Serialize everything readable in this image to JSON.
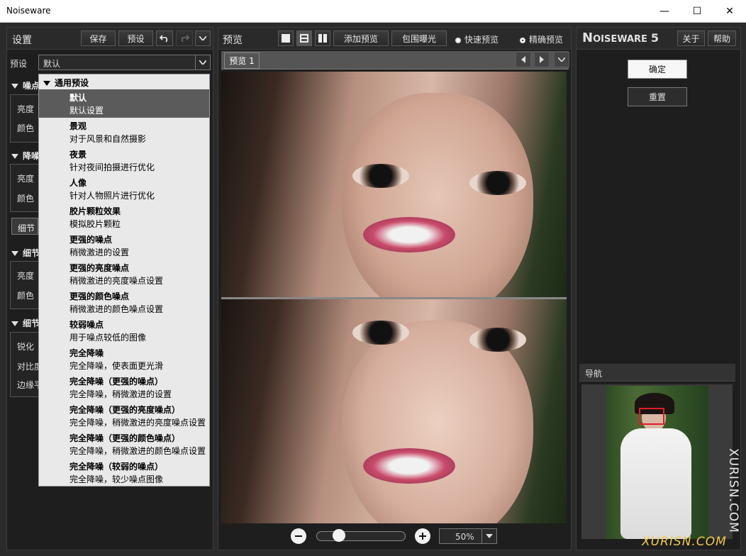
{
  "window": {
    "title": "Noiseware",
    "minimize": "—",
    "maximize": "☐",
    "close": "✕"
  },
  "left": {
    "title": "设置",
    "save": "保存",
    "preset_btn": "预设",
    "preset_label": "预设",
    "preset_value": "默认",
    "sections": [
      {
        "title": "噪点",
        "rows": [
          "亮度",
          "颜色"
        ]
      },
      {
        "title": "降噪",
        "rows": [
          "亮度",
          "颜色"
        ]
      },
      {
        "title": "细节",
        "rows": [
          "亮度",
          "颜色"
        ]
      },
      {
        "title": "细节",
        "rows": [
          "锐化",
          "对比度",
          "边缘平"
        ]
      }
    ],
    "detail_tab": "细节"
  },
  "dropdown": {
    "header": "通用预设",
    "items": [
      {
        "name": "默认",
        "desc": "默认设置"
      },
      {
        "name": "景观",
        "desc": "对于风景和自然摄影"
      },
      {
        "name": "夜景",
        "desc": "针对夜间拍摄进行优化"
      },
      {
        "name": "人像",
        "desc": "针对人物照片进行优化"
      },
      {
        "name": "胶片颗粒效果",
        "desc": "模拟胶片颗粒"
      },
      {
        "name": "更强的噪点",
        "desc": "稍微激进的设置"
      },
      {
        "name": "更强的亮度噪点",
        "desc": "稍微激进的亮度噪点设置"
      },
      {
        "name": "更强的颜色噪点",
        "desc": "稍微激进的颜色噪点设置"
      },
      {
        "name": "较弱噪点",
        "desc": "用于噪点较低的图像"
      },
      {
        "name": "完全降噪",
        "desc": "完全降噪，使表面更光滑"
      },
      {
        "name": "完全降噪（更强的噪点）",
        "desc": "完全降噪，稍微激进的设置"
      },
      {
        "name": "完全降噪（更强的亮度噪点）",
        "desc": "完全降噪，稍微激进的亮度噪点设置"
      },
      {
        "name": "完全降噪（更强的颜色噪点）",
        "desc": "完全降噪，稍微激进的颜色噪点设置"
      },
      {
        "name": "完全降噪（较弱的噪点）",
        "desc": "完全降噪，较少噪点图像"
      }
    ]
  },
  "preview": {
    "title": "预览",
    "add_preview": "添加预览",
    "bracket": "包围曝光",
    "fast": "快速预览",
    "accurate": "精确预览",
    "tab": "预览 1",
    "zoom": "50%",
    "zoom_fraction": 0.2
  },
  "right": {
    "logo_n": "N",
    "logo_rest": "OISEWARE",
    "logo_ver": "5",
    "about": "关于",
    "help": "帮助",
    "ok": "确定",
    "reset": "重置",
    "nav_title": "导航"
  },
  "watermark": "XURISN.COM",
  "colors": {
    "accent_red": "#e11d2a",
    "panel_bg": "#1e1e1e"
  }
}
